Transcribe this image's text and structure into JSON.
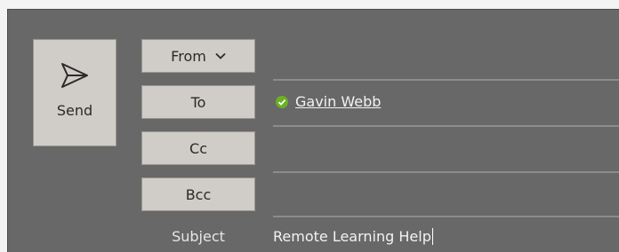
{
  "compose": {
    "send_label": "Send",
    "from_label": "From",
    "to_label": "To",
    "cc_label": "Cc",
    "bcc_label": "Bcc",
    "subject_label": "Subject",
    "subject_value": "Remote Learning Help",
    "to_recipients": [
      {
        "name": "Gavin Webb",
        "status_icon": "check-circle-icon",
        "status_color": "#6ab023"
      }
    ],
    "cc_value": "",
    "bcc_value": ""
  },
  "colors": {
    "background": "#686868",
    "button": "#d0ccc8",
    "text_light": "#f2f2f2"
  }
}
